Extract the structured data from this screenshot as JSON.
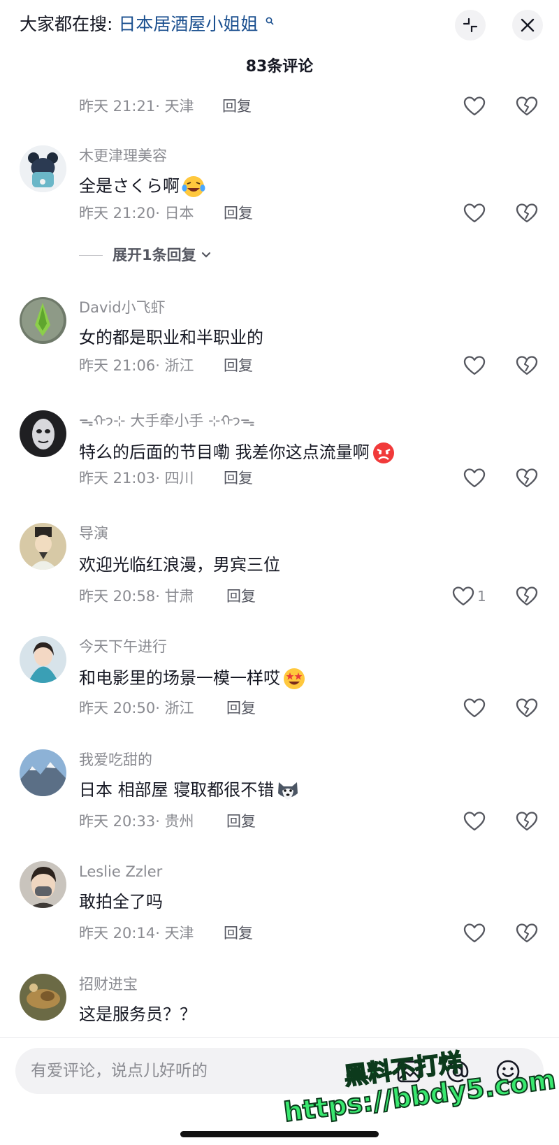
{
  "header": {
    "search_prefix": "大家都在搜:",
    "search_query": "日本居酒屋小姐姐",
    "comment_count": "83条评论"
  },
  "first_meta": {
    "time": "昨天 21:21",
    "location": "天津",
    "reply": "回复"
  },
  "comments": [
    {
      "user": "木更津理美容",
      "text": "全是さくら啊",
      "time": "昨天 21:20",
      "location": "日本",
      "reply": "回复",
      "likes": ""
    },
    {
      "user": "David小飞虾",
      "text": "女的都是职业和半职业的",
      "time": "昨天 21:06",
      "location": "浙江",
      "reply": "回复",
      "likes": ""
    },
    {
      "user": "ᯓᡣ𐭩⊹ 大手牵小手 ⊹ᡣ𐭩ᯓ",
      "text": "特么的后面的节目嘞 我差你这点流量啊",
      "time": "昨天 21:03",
      "location": "四川",
      "reply": "回复",
      "likes": ""
    },
    {
      "user": "导演",
      "text": "欢迎光临红浪漫，男宾三位",
      "time": "昨天 20:58",
      "location": "甘肃",
      "reply": "回复",
      "likes": "1"
    },
    {
      "user": "今天下午进行",
      "text": "和电影里的场景一模一样哎",
      "time": "昨天 20:50",
      "location": "浙江",
      "reply": "回复",
      "likes": ""
    },
    {
      "user": "我爱吃甜的",
      "text": "日本 相部屋 寝取都很不错",
      "time": "昨天 20:33",
      "location": "贵州",
      "reply": "回复",
      "likes": ""
    },
    {
      "user": "Leslie Zzler",
      "text": "敢拍全了吗",
      "time": "昨天 20:14",
      "location": "天津",
      "reply": "回复",
      "likes": ""
    },
    {
      "user": "招财进宝",
      "text": "这是服务员？？"
    }
  ],
  "expand_replies": "展开1条回复",
  "composer": {
    "placeholder": "有爱评论，说点儿好听的"
  },
  "watermark": {
    "line1": "黑料不打烊",
    "line2": "https://bbdy5.com"
  },
  "icons": {
    "search_hint": "search-icon",
    "collapse": "collapse-icon",
    "close": "close-icon",
    "like": "heart-outline-icon",
    "dislike": "broken-heart-icon",
    "image": "image-icon",
    "mention": "at-icon",
    "emoji": "smiley-icon"
  },
  "colors": {
    "query_link": "#1a4f8f",
    "watermark_green": "#39e86f"
  }
}
